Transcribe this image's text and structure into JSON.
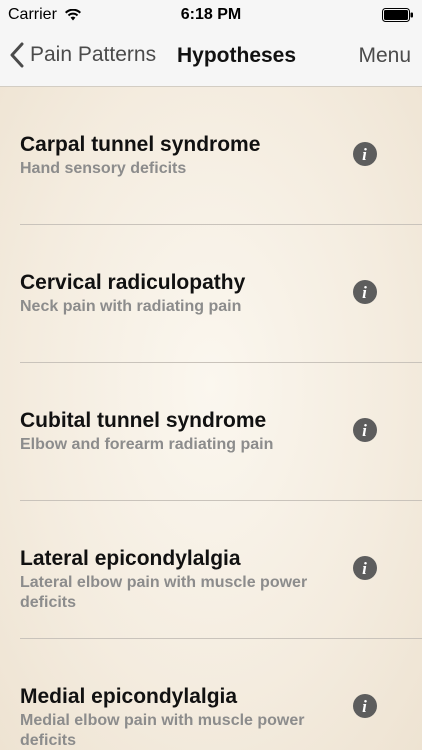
{
  "status_bar": {
    "carrier": "Carrier",
    "time": "6:18 PM"
  },
  "nav": {
    "back_label": "Pain Patterns",
    "title": "Hypotheses",
    "menu_label": "Menu"
  },
  "items": [
    {
      "title": "Carpal tunnel syndrome",
      "subtitle": "Hand sensory deficits"
    },
    {
      "title": "Cervical radiculopathy",
      "subtitle": "Neck pain with radiating pain"
    },
    {
      "title": "Cubital tunnel syndrome",
      "subtitle": "Elbow and forearm radiating pain"
    },
    {
      "title": "Lateral epicondylalgia",
      "subtitle": "Lateral elbow pain with muscle power deficits"
    },
    {
      "title": "Medial epicondylalgia",
      "subtitle": "Medial elbow pain with muscle power deficits"
    }
  ],
  "info_glyph": "i",
  "icons": {
    "wifi": "wifi-icon",
    "battery": "battery-icon",
    "back": "chevron-left-icon",
    "info": "info-icon"
  },
  "colors": {
    "background": "#f5eee2",
    "bar": "#f6f6f6",
    "subtitle": "#8c8c8c",
    "info_icon": "#5d5d5d"
  }
}
